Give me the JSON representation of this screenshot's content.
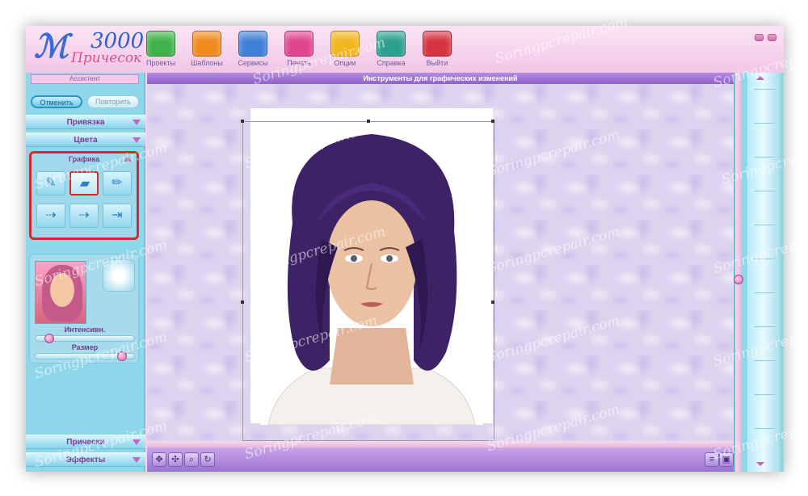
{
  "app": {
    "logo_number": "3000",
    "logo_text": "Причесок",
    "accent_color": "#a37ad8",
    "panel_color": "#8ed6ea"
  },
  "toolbar": {
    "items": [
      {
        "label": "Проекты",
        "icon": "projects-icon",
        "color": "#3fb24a"
      },
      {
        "label": "Шаблоны",
        "icon": "templates-icon",
        "color": "#f08a1c"
      },
      {
        "label": "Сервисы",
        "icon": "services-icon",
        "color": "#3f7fd8"
      },
      {
        "label": "Печать",
        "icon": "print-icon",
        "color": "#e0448f"
      },
      {
        "label": "Опции",
        "icon": "options-icon",
        "color": "#f1b51e"
      },
      {
        "label": "Справка",
        "icon": "help-icon",
        "color": "#2aa08f"
      },
      {
        "label": "Выйти",
        "icon": "exit-icon",
        "color": "#d63240"
      }
    ]
  },
  "left_panel": {
    "assistant_label": "Ассистент",
    "undo_label": "Отменить",
    "redo_label": "Повторить",
    "binding_label": "Привязка",
    "colors_label": "Цвета",
    "graphics": {
      "title": "Графика",
      "tools": [
        {
          "icon": "brush-icon",
          "glyph": "✎",
          "active": false
        },
        {
          "icon": "eraser-icon",
          "glyph": "▰",
          "active": true
        },
        {
          "icon": "pen-icon",
          "glyph": "✏",
          "active": false
        },
        {
          "icon": "line-arrow-icon",
          "glyph": "⇢",
          "active": false
        },
        {
          "icon": "fade-arrow-icon",
          "glyph": "⇢",
          "active": false
        },
        {
          "icon": "end-arrow-icon",
          "glyph": "⇥",
          "active": false
        }
      ]
    },
    "intensity_label": "Интенсивн.",
    "size_label": "Размер",
    "intensity_value": 0.1,
    "size_value": 0.9,
    "hairstyles_label": "Прически",
    "effects_label": "Эффекты"
  },
  "canvas": {
    "title": "Инструменты для графических изменений"
  },
  "watermark_text": "Soringpcrepair.com"
}
